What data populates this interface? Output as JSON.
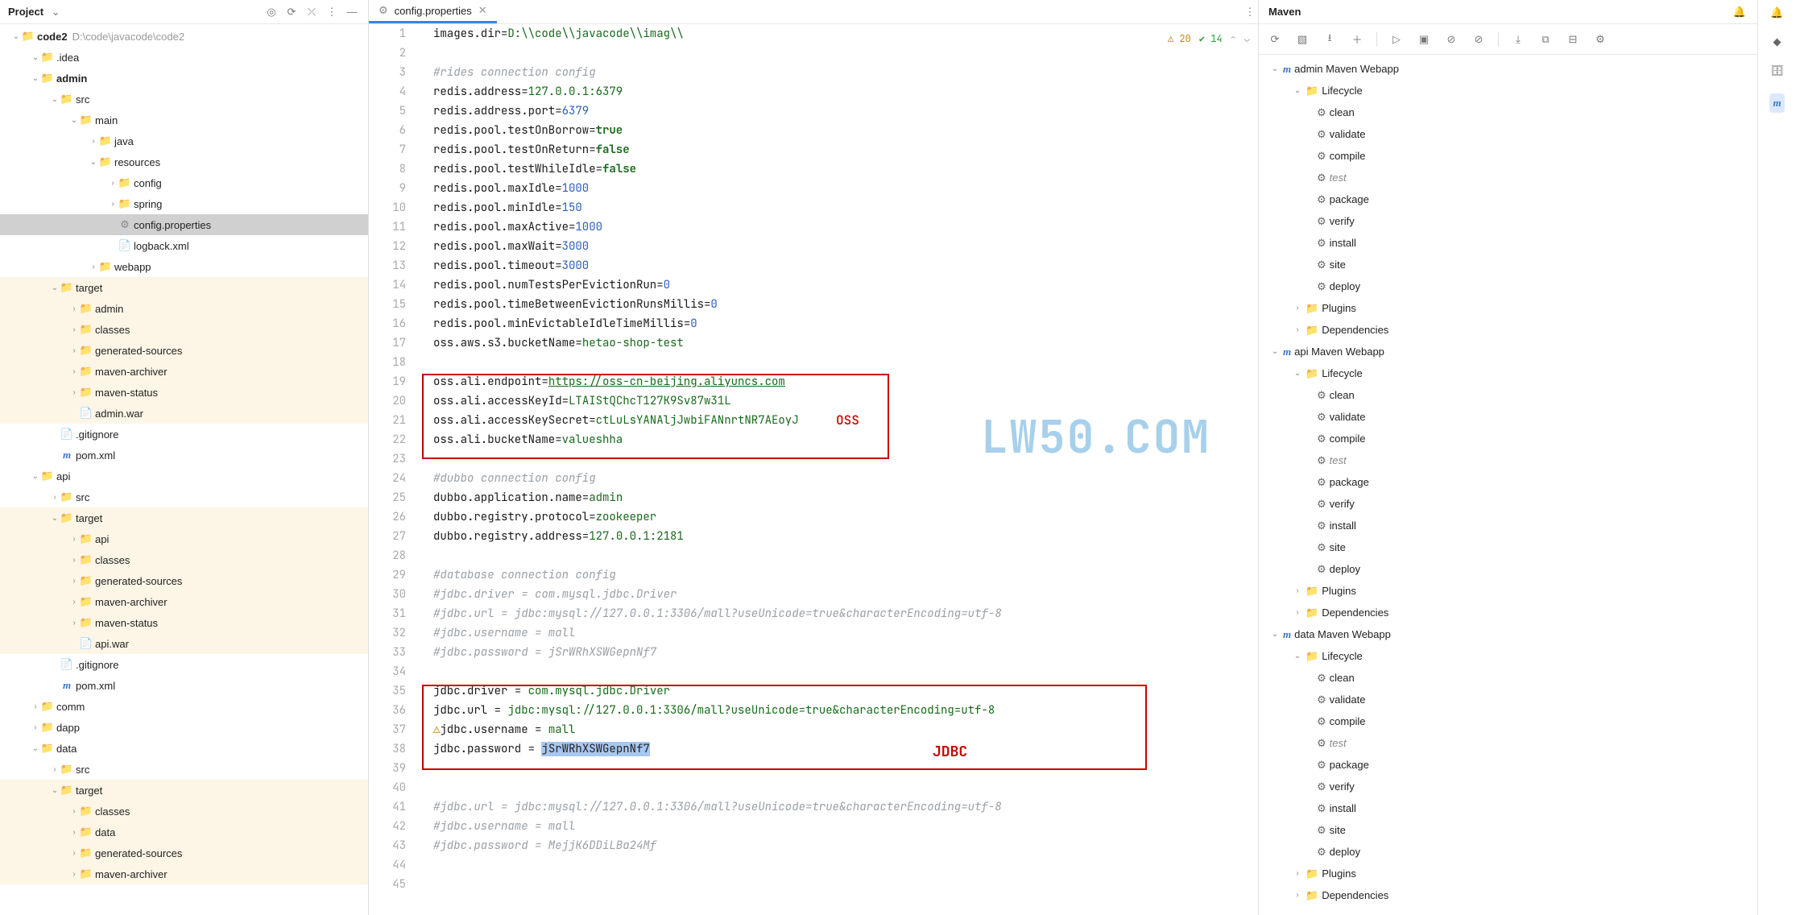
{
  "project": {
    "title": "Project",
    "root": {
      "name": "code2",
      "path": "D:\\code\\javacode\\code2"
    },
    "tree": [
      {
        "depth": 1,
        "chev": "v",
        "icon": "folder",
        "iconcls": "fld",
        "name": ".idea",
        "tinted": false
      },
      {
        "depth": 1,
        "chev": "v",
        "icon": "folder",
        "iconcls": "fld",
        "name": "admin",
        "tinted": false,
        "bold": true
      },
      {
        "depth": 2,
        "chev": "v",
        "icon": "folder",
        "iconcls": "fld",
        "name": "src",
        "tinted": false
      },
      {
        "depth": 3,
        "chev": "v",
        "icon": "folder",
        "iconcls": "fld",
        "name": "main",
        "tinted": false
      },
      {
        "depth": 4,
        "chev": ">",
        "icon": "folder",
        "iconcls": "fld",
        "name": "java",
        "tinted": false
      },
      {
        "depth": 4,
        "chev": "v",
        "icon": "folder",
        "iconcls": "fld",
        "name": "resources",
        "tinted": false
      },
      {
        "depth": 5,
        "chev": ">",
        "icon": "folder",
        "iconcls": "fld",
        "name": "config",
        "tinted": false
      },
      {
        "depth": 5,
        "chev": ">",
        "icon": "folder",
        "iconcls": "fld",
        "name": "spring",
        "tinted": false
      },
      {
        "depth": 5,
        "chev": "",
        "icon": "gear",
        "iconcls": "gear-ico",
        "name": "config.properties",
        "tinted": false,
        "selected": true
      },
      {
        "depth": 5,
        "chev": "",
        "icon": "file",
        "iconcls": "file-ico",
        "name": "logback.xml",
        "tinted": false
      },
      {
        "depth": 4,
        "chev": ">",
        "icon": "folder",
        "iconcls": "fld",
        "name": "webapp",
        "tinted": false
      },
      {
        "depth": 2,
        "chev": "v",
        "icon": "folder",
        "iconcls": "fld-y",
        "name": "target",
        "tinted": true
      },
      {
        "depth": 3,
        "chev": ">",
        "icon": "folder",
        "iconcls": "fld-y",
        "name": "admin",
        "tinted": true
      },
      {
        "depth": 3,
        "chev": ">",
        "icon": "folder",
        "iconcls": "fld-y",
        "name": "classes",
        "tinted": true
      },
      {
        "depth": 3,
        "chev": ">",
        "icon": "folder",
        "iconcls": "fld-y",
        "name": "generated-sources",
        "tinted": true
      },
      {
        "depth": 3,
        "chev": ">",
        "icon": "folder",
        "iconcls": "fld-y",
        "name": "maven-archiver",
        "tinted": true
      },
      {
        "depth": 3,
        "chev": ">",
        "icon": "folder",
        "iconcls": "fld-y",
        "name": "maven-status",
        "tinted": true
      },
      {
        "depth": 3,
        "chev": "",
        "icon": "file",
        "iconcls": "fld-y",
        "name": "admin.war",
        "tinted": true
      },
      {
        "depth": 2,
        "chev": "",
        "icon": "file",
        "iconcls": "file-ico",
        "name": ".gitignore",
        "tinted": false
      },
      {
        "depth": 2,
        "chev": "",
        "icon": "m",
        "iconcls": "m-ico",
        "name": "pom.xml",
        "tinted": false
      },
      {
        "depth": 1,
        "chev": "v",
        "icon": "folder",
        "iconcls": "fld",
        "name": "api",
        "tinted": false
      },
      {
        "depth": 2,
        "chev": ">",
        "icon": "folder",
        "iconcls": "fld",
        "name": "src",
        "tinted": false
      },
      {
        "depth": 2,
        "chev": "v",
        "icon": "folder",
        "iconcls": "fld-y",
        "name": "target",
        "tinted": true
      },
      {
        "depth": 3,
        "chev": ">",
        "icon": "folder",
        "iconcls": "fld-y",
        "name": "api",
        "tinted": true
      },
      {
        "depth": 3,
        "chev": ">",
        "icon": "folder",
        "iconcls": "fld-y",
        "name": "classes",
        "tinted": true
      },
      {
        "depth": 3,
        "chev": ">",
        "icon": "folder",
        "iconcls": "fld-y",
        "name": "generated-sources",
        "tinted": true
      },
      {
        "depth": 3,
        "chev": ">",
        "icon": "folder",
        "iconcls": "fld-y",
        "name": "maven-archiver",
        "tinted": true
      },
      {
        "depth": 3,
        "chev": ">",
        "icon": "folder",
        "iconcls": "fld-y",
        "name": "maven-status",
        "tinted": true
      },
      {
        "depth": 3,
        "chev": "",
        "icon": "file",
        "iconcls": "fld-y",
        "name": "api.war",
        "tinted": true
      },
      {
        "depth": 2,
        "chev": "",
        "icon": "file",
        "iconcls": "file-ico",
        "name": ".gitignore",
        "tinted": false
      },
      {
        "depth": 2,
        "chev": "",
        "icon": "m",
        "iconcls": "m-ico",
        "name": "pom.xml",
        "tinted": false
      },
      {
        "depth": 1,
        "chev": ">",
        "icon": "folder",
        "iconcls": "fld",
        "name": "comm",
        "tinted": false
      },
      {
        "depth": 1,
        "chev": ">",
        "icon": "folder",
        "iconcls": "fld",
        "name": "dapp",
        "tinted": false
      },
      {
        "depth": 1,
        "chev": "v",
        "icon": "folder",
        "iconcls": "fld",
        "name": "data",
        "tinted": false
      },
      {
        "depth": 2,
        "chev": ">",
        "icon": "folder",
        "iconcls": "fld",
        "name": "src",
        "tinted": false
      },
      {
        "depth": 2,
        "chev": "v",
        "icon": "folder",
        "iconcls": "fld-y",
        "name": "target",
        "tinted": true
      },
      {
        "depth": 3,
        "chev": ">",
        "icon": "folder",
        "iconcls": "fld-y",
        "name": "classes",
        "tinted": true
      },
      {
        "depth": 3,
        "chev": ">",
        "icon": "folder",
        "iconcls": "fld-y",
        "name": "data",
        "tinted": true
      },
      {
        "depth": 3,
        "chev": ">",
        "icon": "folder",
        "iconcls": "fld-y",
        "name": "generated-sources",
        "tinted": true
      },
      {
        "depth": 3,
        "chev": ">",
        "icon": "folder",
        "iconcls": "fld-y",
        "name": "maven-archiver",
        "tinted": true
      }
    ]
  },
  "editor": {
    "tab_name": "config.properties",
    "warn_count": "20",
    "check_count": "14",
    "lines": [
      {
        "n": 1,
        "segs": [
          {
            "c": "k",
            "t": "images.dir"
          },
          {
            "c": "",
            "t": "="
          },
          {
            "c": "val",
            "t": "D:\\\\code\\\\javacode\\\\imag\\\\"
          }
        ]
      },
      {
        "n": 2,
        "segs": []
      },
      {
        "n": 3,
        "segs": [
          {
            "c": "cmt",
            "t": "#rides connection config"
          }
        ]
      },
      {
        "n": 4,
        "segs": [
          {
            "c": "k",
            "t": "redis.address"
          },
          {
            "c": "",
            "t": "="
          },
          {
            "c": "val",
            "t": "127.0.0.1:6379"
          }
        ]
      },
      {
        "n": 5,
        "segs": [
          {
            "c": "k",
            "t": "redis.address.port"
          },
          {
            "c": "",
            "t": "="
          },
          {
            "c": "num",
            "t": "6379"
          }
        ]
      },
      {
        "n": 6,
        "segs": [
          {
            "c": "k",
            "t": "redis.pool.testOnBorrow"
          },
          {
            "c": "",
            "t": "="
          },
          {
            "c": "bool",
            "t": "true"
          }
        ]
      },
      {
        "n": 7,
        "segs": [
          {
            "c": "k",
            "t": "redis.pool.testOnReturn"
          },
          {
            "c": "",
            "t": "="
          },
          {
            "c": "bool",
            "t": "false"
          }
        ]
      },
      {
        "n": 8,
        "segs": [
          {
            "c": "k",
            "t": "redis.pool.testWhileIdle"
          },
          {
            "c": "",
            "t": "="
          },
          {
            "c": "bool",
            "t": "false"
          }
        ]
      },
      {
        "n": 9,
        "segs": [
          {
            "c": "k",
            "t": "redis.pool.maxIdle"
          },
          {
            "c": "",
            "t": "="
          },
          {
            "c": "num",
            "t": "1000"
          }
        ]
      },
      {
        "n": 10,
        "segs": [
          {
            "c": "k",
            "t": "redis.pool.minIdle"
          },
          {
            "c": "",
            "t": "="
          },
          {
            "c": "num",
            "t": "150"
          }
        ]
      },
      {
        "n": 11,
        "segs": [
          {
            "c": "k",
            "t": "redis.pool.maxActive"
          },
          {
            "c": "",
            "t": "="
          },
          {
            "c": "num",
            "t": "1000"
          }
        ]
      },
      {
        "n": 12,
        "segs": [
          {
            "c": "k",
            "t": "redis.pool.maxWait"
          },
          {
            "c": "",
            "t": "="
          },
          {
            "c": "num",
            "t": "3000"
          }
        ]
      },
      {
        "n": 13,
        "segs": [
          {
            "c": "k",
            "t": "redis.pool.timeout"
          },
          {
            "c": "",
            "t": "="
          },
          {
            "c": "num",
            "t": "3000"
          }
        ]
      },
      {
        "n": 14,
        "segs": [
          {
            "c": "k",
            "t": "redis.pool.numTestsPerEvictionRun"
          },
          {
            "c": "",
            "t": "="
          },
          {
            "c": "num",
            "t": "0"
          }
        ]
      },
      {
        "n": 15,
        "segs": [
          {
            "c": "k",
            "t": "redis.pool.timeBetweenEvictionRunsMillis"
          },
          {
            "c": "",
            "t": "="
          },
          {
            "c": "num",
            "t": "0"
          }
        ]
      },
      {
        "n": 16,
        "segs": [
          {
            "c": "k",
            "t": "redis.pool.minEvictableIdleTimeMillis"
          },
          {
            "c": "",
            "t": "="
          },
          {
            "c": "num",
            "t": "0"
          }
        ]
      },
      {
        "n": 17,
        "segs": [
          {
            "c": "k",
            "t": "oss.aws.s3.bucketName"
          },
          {
            "c": "",
            "t": "="
          },
          {
            "c": "val",
            "t": "hetao-shop-test"
          }
        ]
      },
      {
        "n": 18,
        "segs": []
      },
      {
        "n": 19,
        "segs": [
          {
            "c": "k",
            "t": "oss.ali.endpoint"
          },
          {
            "c": "",
            "t": "="
          },
          {
            "c": "url",
            "t": "https://oss-cn-beijing.aliyuncs.com"
          }
        ]
      },
      {
        "n": 20,
        "segs": [
          {
            "c": "k",
            "t": "oss.ali.accessKeyId"
          },
          {
            "c": "",
            "t": "="
          },
          {
            "c": "val",
            "t": "LTAIStQChcT127K9Sv87w31L"
          }
        ]
      },
      {
        "n": 21,
        "segs": [
          {
            "c": "k",
            "t": "oss.ali.accessKeySecret"
          },
          {
            "c": "",
            "t": "="
          },
          {
            "c": "val",
            "t": "ctLuLsYANAljJwbiFANnrtNR7AEoyJ"
          }
        ]
      },
      {
        "n": 22,
        "segs": [
          {
            "c": "k",
            "t": "oss.ali.bucketName"
          },
          {
            "c": "",
            "t": "="
          },
          {
            "c": "val",
            "t": "valueshha"
          }
        ]
      },
      {
        "n": 23,
        "segs": []
      },
      {
        "n": 24,
        "segs": [
          {
            "c": "cmt",
            "t": "#dubbo connection config"
          }
        ]
      },
      {
        "n": 25,
        "segs": [
          {
            "c": "k",
            "t": "dubbo.application.name"
          },
          {
            "c": "",
            "t": "="
          },
          {
            "c": "val",
            "t": "admin"
          }
        ]
      },
      {
        "n": 26,
        "segs": [
          {
            "c": "k",
            "t": "dubbo.registry.protocol"
          },
          {
            "c": "",
            "t": "="
          },
          {
            "c": "val",
            "t": "zookeeper"
          }
        ]
      },
      {
        "n": 27,
        "segs": [
          {
            "c": "k",
            "t": "dubbo.registry.address"
          },
          {
            "c": "",
            "t": "="
          },
          {
            "c": "val",
            "t": "127.0.0.1:2181"
          }
        ]
      },
      {
        "n": 28,
        "segs": []
      },
      {
        "n": 29,
        "segs": [
          {
            "c": "cmt",
            "t": "#database connection config"
          }
        ]
      },
      {
        "n": 30,
        "segs": [
          {
            "c": "cmt",
            "t": "#jdbc.driver = com.mysql.jdbc.Driver"
          }
        ]
      },
      {
        "n": 31,
        "segs": [
          {
            "c": "cmt",
            "t": "#jdbc.url = jdbc:mysql://127.0.0.1:3306/mall?useUnicode=true&characterEncoding=utf-8"
          }
        ]
      },
      {
        "n": 32,
        "segs": [
          {
            "c": "cmt",
            "t": "#jdbc.username = mall"
          }
        ]
      },
      {
        "n": 33,
        "segs": [
          {
            "c": "cmt",
            "t": "#jdbc.password = jSrWRhXSWGepnNf7"
          }
        ]
      },
      {
        "n": 34,
        "segs": []
      },
      {
        "n": 35,
        "segs": [
          {
            "c": "k",
            "t": "jdbc.driver "
          },
          {
            "c": "",
            "t": "="
          },
          {
            "c": "val",
            "t": " com.mysql.jdbc.Driver"
          }
        ]
      },
      {
        "n": 36,
        "segs": [
          {
            "c": "k",
            "t": "jdbc.url "
          },
          {
            "c": "",
            "t": "="
          },
          {
            "c": "val",
            "t": " jdbc:mysql://127.0.0.1:3306/mall?useUnicode=true&characterEncoding=utf-8"
          }
        ]
      },
      {
        "n": 37,
        "segs": [
          {
            "c": "k",
            "t": "jdbc.username "
          },
          {
            "c": "",
            "t": "="
          },
          {
            "c": "val",
            "t": " mall"
          }
        ],
        "warn": true
      },
      {
        "n": 38,
        "segs": [
          {
            "c": "k",
            "t": "jdbc.password "
          },
          {
            "c": "",
            "t": "="
          },
          {
            "c": "",
            "t": " "
          },
          {
            "c": "sel",
            "t": "jSrWRhXSWGepnNf7"
          }
        ]
      },
      {
        "n": 39,
        "segs": []
      },
      {
        "n": 40,
        "segs": []
      },
      {
        "n": 41,
        "segs": [
          {
            "c": "cmt",
            "t": "#jdbc.url = jdbc:mysql://127.0.0.1:3306/mall?useUnicode=true&characterEncoding=utf-8"
          }
        ]
      },
      {
        "n": 42,
        "segs": [
          {
            "c": "cmt",
            "t": "#jdbc.username = mall"
          }
        ]
      },
      {
        "n": 43,
        "segs": [
          {
            "c": "cmt",
            "t": "#jdbc.password = MejjK6DDiLBa24Mf"
          }
        ]
      },
      {
        "n": 44,
        "segs": []
      },
      {
        "n": 45,
        "segs": []
      }
    ],
    "annotations": {
      "oss": "OSS",
      "jdbc": "JDBC",
      "watermark": "LW50.COM"
    }
  },
  "maven": {
    "title": "Maven",
    "modules": [
      {
        "name": "admin Maven Webapp",
        "lifecycle_open": true,
        "goals": [
          "clean",
          "validate",
          "compile",
          "test",
          "package",
          "verify",
          "install",
          "site",
          "deploy"
        ]
      },
      {
        "name": "api Maven Webapp",
        "lifecycle_open": true,
        "goals": [
          "clean",
          "validate",
          "compile",
          "test",
          "package",
          "verify",
          "install",
          "site",
          "deploy"
        ]
      },
      {
        "name": "data Maven Webapp",
        "lifecycle_open": true,
        "goals": [
          "clean",
          "validate",
          "compile",
          "test",
          "package",
          "verify",
          "install",
          "site",
          "deploy"
        ]
      }
    ],
    "subnodes": {
      "lifecycle": "Lifecycle",
      "plugins": "Plugins",
      "dependencies": "Dependencies"
    }
  }
}
